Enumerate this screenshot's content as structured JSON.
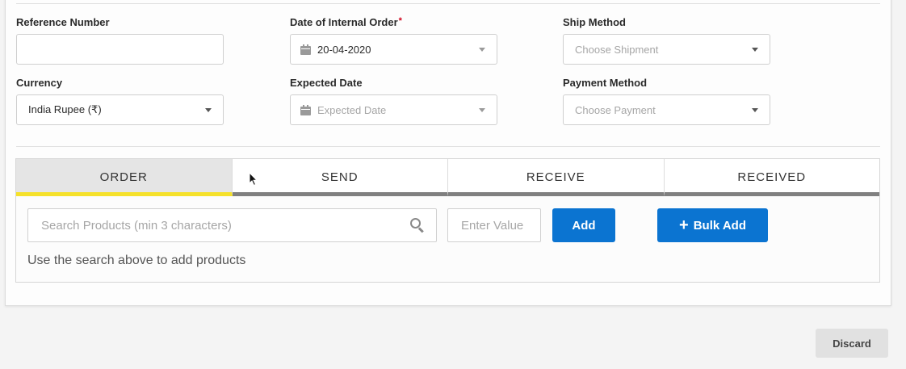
{
  "form": {
    "reference_number": {
      "label": "Reference Number",
      "value": ""
    },
    "date_of_internal_order": {
      "label": "Date of Internal Order",
      "required_mark": "*",
      "value": "20-04-2020"
    },
    "ship_method": {
      "label": "Ship Method",
      "placeholder": "Choose Shipment"
    },
    "currency": {
      "label": "Currency",
      "value": "India Rupee (₹)"
    },
    "expected_date": {
      "label": "Expected Date",
      "placeholder": "Expected Date"
    },
    "payment_method": {
      "label": "Payment Method",
      "placeholder": "Choose Payment"
    }
  },
  "tabs": [
    {
      "label": "ORDER",
      "active": true
    },
    {
      "label": "SEND",
      "active": false
    },
    {
      "label": "RECEIVE",
      "active": false
    },
    {
      "label": "RECEIVED",
      "active": false
    }
  ],
  "products": {
    "search_placeholder": "Search Products (min 3 characters)",
    "value_placeholder": "Enter Value",
    "add_label": "Add",
    "bulk_add_label": "Bulk Add",
    "hint": "Use the search above to add products"
  },
  "footer": {
    "discard_label": "Discard"
  },
  "colors": {
    "primary": "#0b74d1",
    "active_tab_underline": "#f5e12a",
    "required": "#d0021b"
  }
}
